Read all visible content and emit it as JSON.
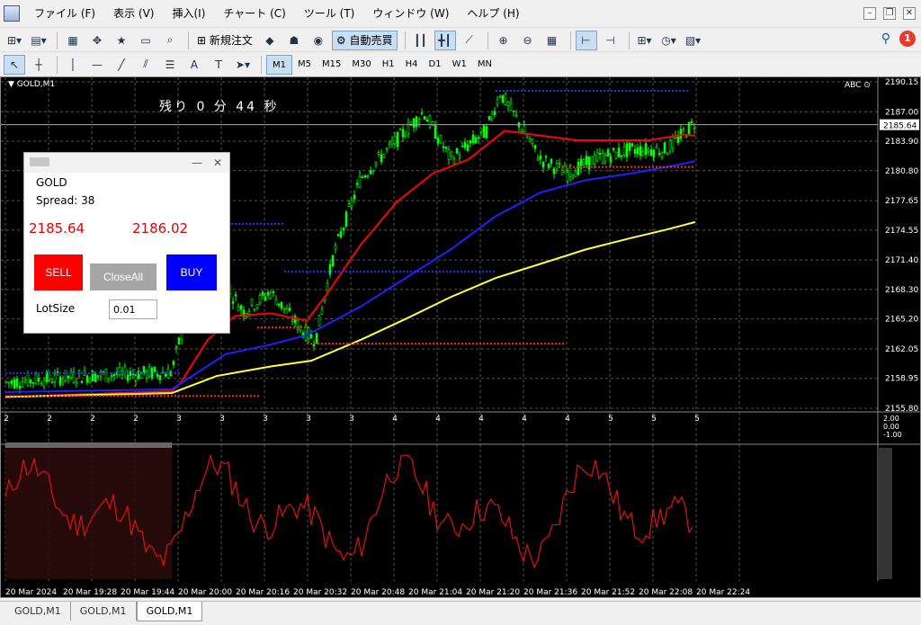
{
  "menu": [
    "ファイル (F)",
    "表示 (V)",
    "挿入(I)",
    "チャート (C)",
    "ツール (T)",
    "ウィンドウ (W)",
    "ヘルプ (H)"
  ],
  "toolbar": {
    "new_order": "新規注文",
    "auto_trade": "自動売買",
    "notifications": "1"
  },
  "timeframes": [
    "M1",
    "M5",
    "M15",
    "M30",
    "H1",
    "H4",
    "D1",
    "W1",
    "MN"
  ],
  "chart": {
    "title": "GOLD,M1",
    "countdown": "残り 0 分 44 秒",
    "abc_label": "ABC",
    "current_price": "2185.64",
    "price_ticks": [
      "2190.15",
      "2187.00",
      "2183.90",
      "2180.80",
      "2177.65",
      "2174.55",
      "2171.40",
      "2168.30",
      "2165.20",
      "2162.05",
      "2158.95",
      "2155.80"
    ],
    "time_labels": [
      "20 Mar 2024",
      "20 Mar 19:28",
      "20 Mar 19:44",
      "20 Mar 20:00",
      "20 Mar 20:16",
      "20 Mar 20:32",
      "20 Mar 20:48",
      "20 Mar 21:04",
      "20 Mar 21:20",
      "20 Mar 21:36",
      "20 Mar 21:52",
      "20 Mar 22:08",
      "20 Mar 22:24"
    ],
    "indicator_ticks": [
      "2",
      "2",
      "2",
      "2",
      "3",
      "3",
      "3",
      "3",
      "3",
      "4",
      "4",
      "4",
      "4",
      "4",
      "5",
      "5",
      "5"
    ],
    "indicator_scale": [
      "2.00",
      "0.00",
      "-1.00"
    ],
    "colors": {
      "ma_red": "#ff0000",
      "ma_blue": "#2020ff",
      "ma_yellow": "#ffff40",
      "candles": "#00ff00"
    }
  },
  "panel": {
    "symbol": "GOLD",
    "spread": "Spread: 38",
    "bid": "2185.64",
    "ask": "2186.02",
    "sell": "SELL",
    "close_all": "CloseAll",
    "buy": "BUY",
    "lot_label": "LotSize",
    "lot_value": "0.01"
  },
  "tabs": [
    "GOLD,M1",
    "GOLD,M1",
    "GOLD,M1"
  ]
}
